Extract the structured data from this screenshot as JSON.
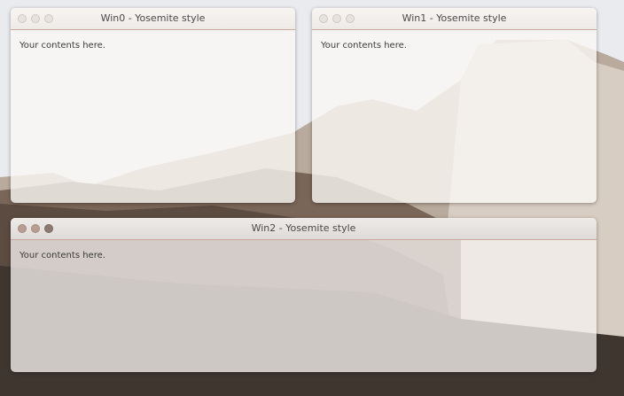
{
  "windows": [
    {
      "title": "Win0 - Yosemite style",
      "content": "Your contents here.",
      "active": false
    },
    {
      "title": "Win1 - Yosemite style",
      "content": "Your contents here.",
      "active": false
    },
    {
      "title": "Win2 - Yosemite style",
      "content": "Your contents here.",
      "active": true
    }
  ],
  "colors": {
    "title_separator": "#c9a99a",
    "active_dot": "#b89d92",
    "active_dot_dark": "#8d7a73",
    "inactive_dot": "#e6e2df"
  },
  "icons": [
    "close-icon",
    "minimize-icon",
    "maximize-icon"
  ]
}
